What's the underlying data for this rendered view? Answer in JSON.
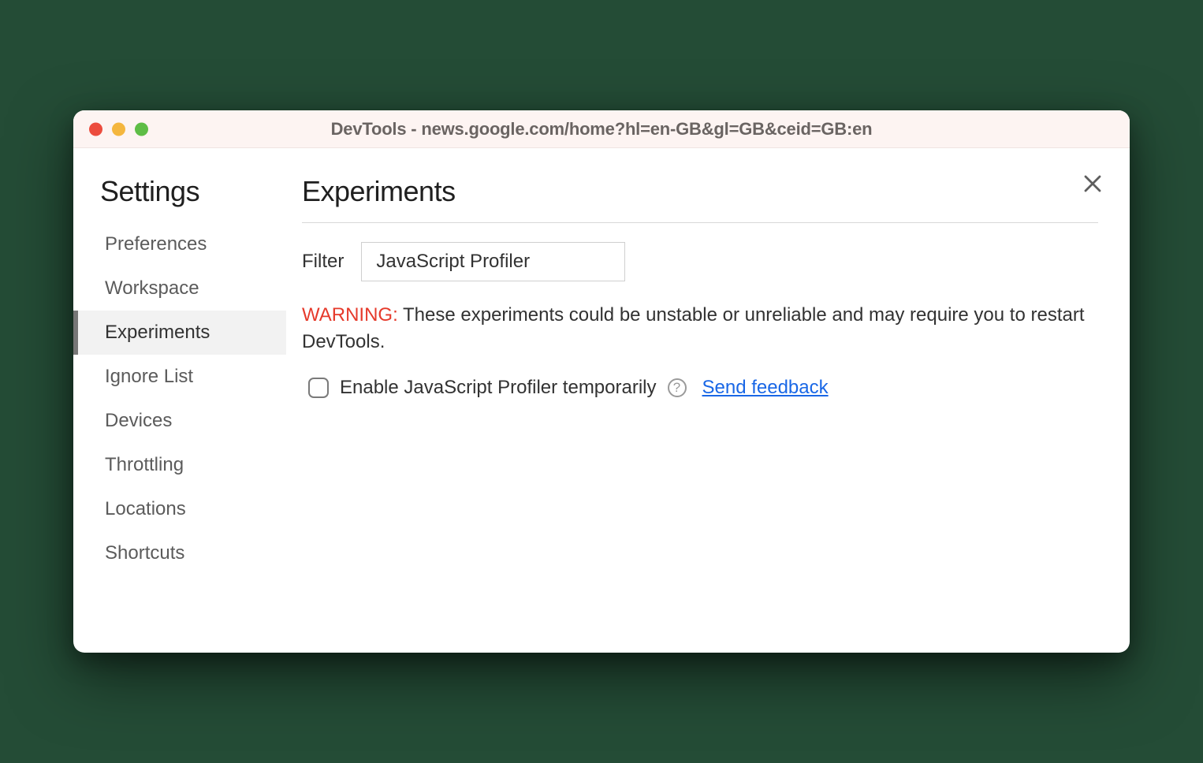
{
  "window": {
    "title": "DevTools - news.google.com/home?hl=en-GB&gl=GB&ceid=GB:en"
  },
  "sidebar": {
    "title": "Settings",
    "items": [
      {
        "label": "Preferences",
        "active": false
      },
      {
        "label": "Workspace",
        "active": false
      },
      {
        "label": "Experiments",
        "active": true
      },
      {
        "label": "Ignore List",
        "active": false
      },
      {
        "label": "Devices",
        "active": false
      },
      {
        "label": "Throttling",
        "active": false
      },
      {
        "label": "Locations",
        "active": false
      },
      {
        "label": "Shortcuts",
        "active": false
      }
    ]
  },
  "content": {
    "title": "Experiments",
    "filter": {
      "label": "Filter",
      "value": "JavaScript Profiler"
    },
    "warning": {
      "prefix": "WARNING:",
      "text": " These experiments could be unstable or unreliable and may require you to restart DevTools."
    },
    "experiment": {
      "checked": false,
      "label": "Enable JavaScript Profiler temporarily",
      "help_char": "?",
      "feedback_label": "Send feedback"
    }
  }
}
